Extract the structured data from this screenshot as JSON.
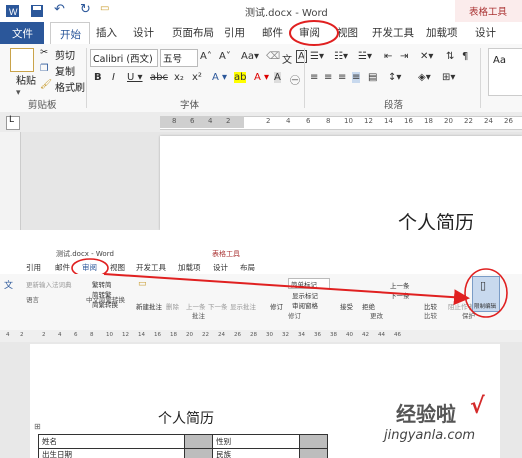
{
  "top": {
    "window_title": "测试.docx - Word",
    "table_tools_label": "表格工具",
    "tabs": [
      "文件",
      "开始",
      "插入",
      "设计",
      "页面布局",
      "引用",
      "邮件",
      "审阅",
      "视图",
      "开发工具",
      "加载项",
      "设计"
    ],
    "clipboard": {
      "paste": "粘贴",
      "cut": "剪切",
      "copy": "复制",
      "format_painter": "格式刷",
      "group": "剪贴板"
    },
    "font": {
      "name": "Calibri (西文)",
      "size": "五号",
      "group": "字体"
    },
    "paragraph_group": "段落",
    "ruler_numbers": [
      "8",
      "6",
      "4",
      "2",
      "2",
      "4",
      "6",
      "8",
      "10",
      "12",
      "14",
      "16",
      "18",
      "20",
      "22",
      "24",
      "26"
    ],
    "doc_title": "个人简历"
  },
  "bottom": {
    "window_title": "测试.docx - Word",
    "table_tools_label": "表格工具",
    "tabs": [
      "引用",
      "邮件",
      "审阅",
      "视图",
      "开发工具",
      "加载项",
      "设计",
      "布局"
    ],
    "ribbon": {
      "update_input": "更新输入法词典",
      "lang": "语言",
      "trad_simp": [
        "繁转简",
        "简转繁",
        "简繁转换"
      ],
      "trad_group": "中文简繁转换",
      "comments": [
        "新建批注",
        "删除",
        "上一条",
        "下一条",
        "显示批注"
      ],
      "comments_group": "批注",
      "revision": [
        "修订",
        "简单标记",
        "显示标记",
        "审阅窗格"
      ],
      "revision_group": "修订",
      "changes": [
        "接受",
        "拒绝",
        "上一条",
        "下一条"
      ],
      "changes_group": "更改",
      "compare": "比较",
      "compare_group": "比较",
      "protect": [
        "阻止作者",
        "限制编辑"
      ],
      "protect_group": "保护"
    },
    "ruler_numbers": [
      "4",
      "2",
      "2",
      "4",
      "6",
      "8",
      "10",
      "12",
      "14",
      "16",
      "18",
      "20",
      "22",
      "24",
      "26",
      "28",
      "30",
      "32",
      "34",
      "36",
      "38",
      "40",
      "42",
      "44",
      "46"
    ],
    "doc_title": "个人简历",
    "table": [
      [
        "姓名",
        "",
        "性别",
        ""
      ],
      [
        "出生日期",
        "",
        "民族",
        ""
      ]
    ]
  },
  "watermark": {
    "text": "经验啦",
    "check": "√",
    "url": "jingyanla.com"
  },
  "colors": {
    "accent": "#2b579a",
    "highlight": "#e02020",
    "table_shade": "#bdbdbd"
  }
}
